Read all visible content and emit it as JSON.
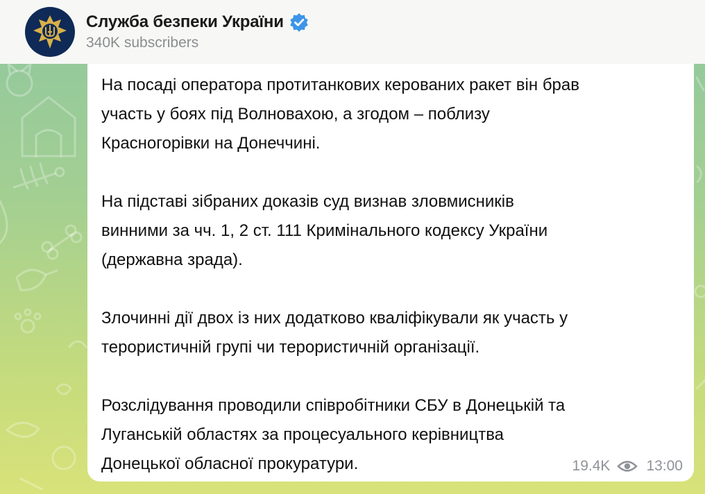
{
  "channel": {
    "title": "Служба безпеки України",
    "subscribers": "340K subscribers",
    "avatar_icon": "sbu-emblem-icon",
    "verified_icon": "verified-badge-icon"
  },
  "message": {
    "paragraphs": [
      "На посаді оператора протитанкових керованих ракет він брав\nучасть у боях під Волновахою, а згодом – поблизу\nКрасногорівки на Донеччині.",
      "На підставі зібраних доказів суд визнав зловмисників\nвинними за чч. 1, 2 ст. 111 Кримінального кодексу України\n(державна зрада).",
      "Злочинні дії двох із них додатково кваліфікували як участь у\nтерористичній групі чи терористичній організації.",
      "Розслідування проводили співробітники СБУ в Донецькій та\nЛуганській областях за процесуального керівництва\nДонецької обласної прокуратури."
    ],
    "views": "19.4K",
    "views_icon": "eye-icon",
    "time": "13:00"
  },
  "colors": {
    "header_bg": "#f7f8f5",
    "avatar_bg": "#0f2a56",
    "emblem_gold": "#d9b04a",
    "verified_blue": "#3d95e8",
    "meta_gray": "#8f9297"
  }
}
